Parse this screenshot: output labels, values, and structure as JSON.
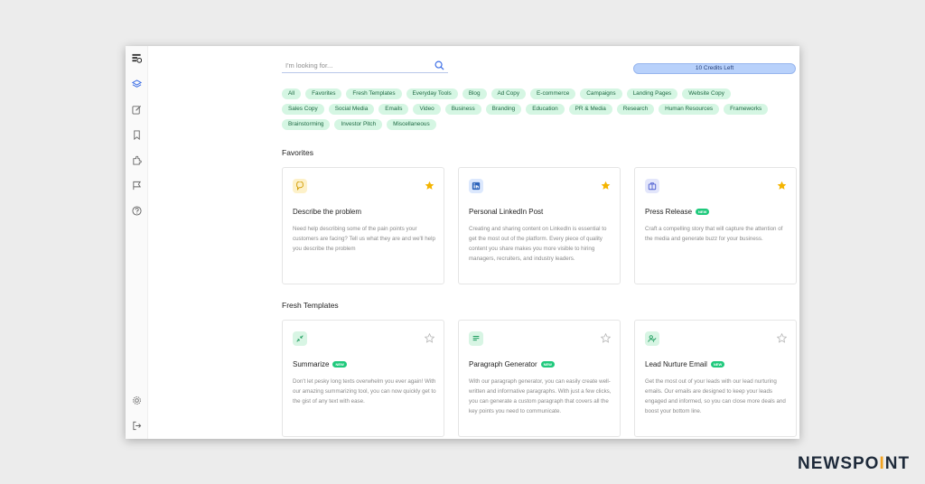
{
  "search": {
    "placeholder": "I'm looking for..."
  },
  "credits": {
    "label": "10 Credits Left"
  },
  "sidebar": {
    "top_icons": [
      "app-logo-icon",
      "layers-icon",
      "edit-icon",
      "bookmark-icon",
      "puzzle-icon",
      "flag-icon",
      "help-icon"
    ],
    "bottom_icons": [
      "settings-icon",
      "logout-icon"
    ]
  },
  "categories": {
    "row1": [
      "All",
      "Favorites",
      "Fresh Templates",
      "Everyday Tools",
      "Blog",
      "Ad Copy",
      "E-commerce",
      "Campaigns",
      "Landing Pages",
      "Website Copy"
    ],
    "row2": [
      "Sales Copy",
      "Social Media",
      "Emails",
      "Video",
      "Business",
      "Branding",
      "Education",
      "PR & Media",
      "Research",
      "Human Resources",
      "Frameworks"
    ],
    "row3": [
      "Brainstorming",
      "Investor Pitch",
      "Miscellaneous"
    ]
  },
  "sections": {
    "favorites": {
      "title": "Favorites",
      "cards": [
        {
          "icon": "chat-bubble-icon",
          "title": "Describe the problem",
          "badge": "",
          "starred": true,
          "description": "Need help describing some of the pain points your customers are facing? Tell us what they are and we'll help you describe the problem"
        },
        {
          "icon": "linkedin-icon",
          "title": "Personal LinkedIn Post",
          "badge": "",
          "starred": true,
          "description": "Creating and sharing content on LinkedIn is essential to get the most out of the platform. Every piece of quality content you share makes you more visible to hiring managers, recruiters, and industry leaders."
        },
        {
          "icon": "briefcase-icon",
          "title": "Press Release",
          "badge": "NEW",
          "starred": true,
          "description": "Craft a compelling story that will capture the attention of the media and generate buzz for your business."
        }
      ]
    },
    "fresh": {
      "title": "Fresh Templates",
      "cards": [
        {
          "icon": "compress-icon",
          "title": "Summarize",
          "badge": "NEW",
          "starred": false,
          "description": "Don't let pesky long texts overwhelm you ever again! With our amazing summarizing tool, you can now quickly get to the gist of any text with ease."
        },
        {
          "icon": "paragraph-icon",
          "title": "Paragraph Generator",
          "badge": "NEW",
          "starred": false,
          "description": "With our paragraph generator, you can easily create well-written and informative paragraphs. With just a few clicks, you can generate a custom paragraph that covers all the key points you need to communicate."
        },
        {
          "icon": "user-check-icon",
          "title": "Lead Nurture Email",
          "badge": "NEW",
          "starred": false,
          "description": "Get the most out of your leads with our lead nurturing emails. Our emails are designed to keep your leads engaged and informed, so you can close more deals and boost your bottom line."
        }
      ]
    }
  },
  "colors": {
    "chip_bg": "#d5f6e3",
    "chip_text": "#1e6a43",
    "credits_bg": "#b8d1fb",
    "badge_bg": "#1fc97c",
    "star_filled": "#f4b400",
    "logo_dot": "#f2a321"
  },
  "watermark": {
    "text_start": "NEWSPO",
    "text_dot": "I",
    "text_end": "NT"
  }
}
